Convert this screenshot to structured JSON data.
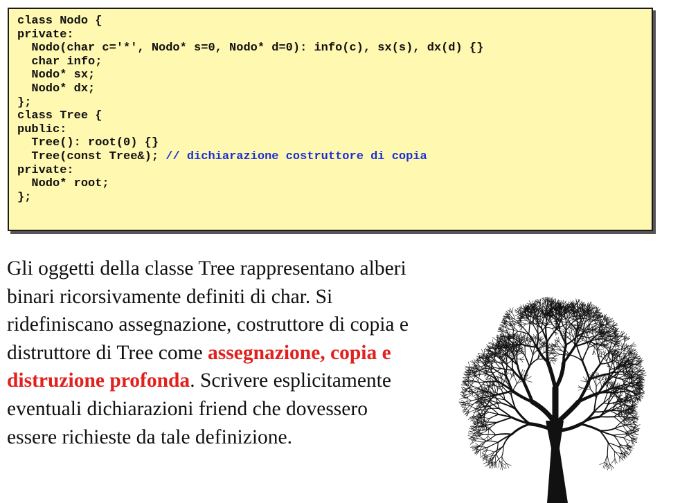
{
  "code": {
    "lines": [
      "class Nodo {",
      "private:",
      "  Nodo(char c='*', Nodo* s=0, Nodo* d=0): info(c), sx(s), dx(d) {}",
      "  char info;",
      "  Nodo* sx;",
      "  Nodo* dx;",
      "};",
      "class Tree {",
      "public:",
      "  Tree(): root(0) {}",
      "  Tree(const Tree&);",
      "private:",
      "  Nodo* root;",
      "};"
    ],
    "comment": " // dichiarazione costruttore di copia"
  },
  "description": {
    "line1": "Gli oggetti della classe Tree rappresentano alberi",
    "line2": "binari ricorsivamente definiti di char. Si",
    "line3": "ridefiniscano assegnazione, costruttore di copia e",
    "line4_normal": "distruttore di Tree come ",
    "line4_highlight": "assegnazione, copia e",
    "line5_highlight": "distruzione profonda",
    "line5_normal": ". Scrivere esplicitamente",
    "line6": "eventuali dichiarazioni friend che dovessero",
    "line7": "essere richieste da tale definizione."
  },
  "colors": {
    "code_background": "#fff8b0",
    "comment": "#1a2fd6",
    "highlight": "#e0211e"
  },
  "image": {
    "icon": "tree-icon"
  }
}
